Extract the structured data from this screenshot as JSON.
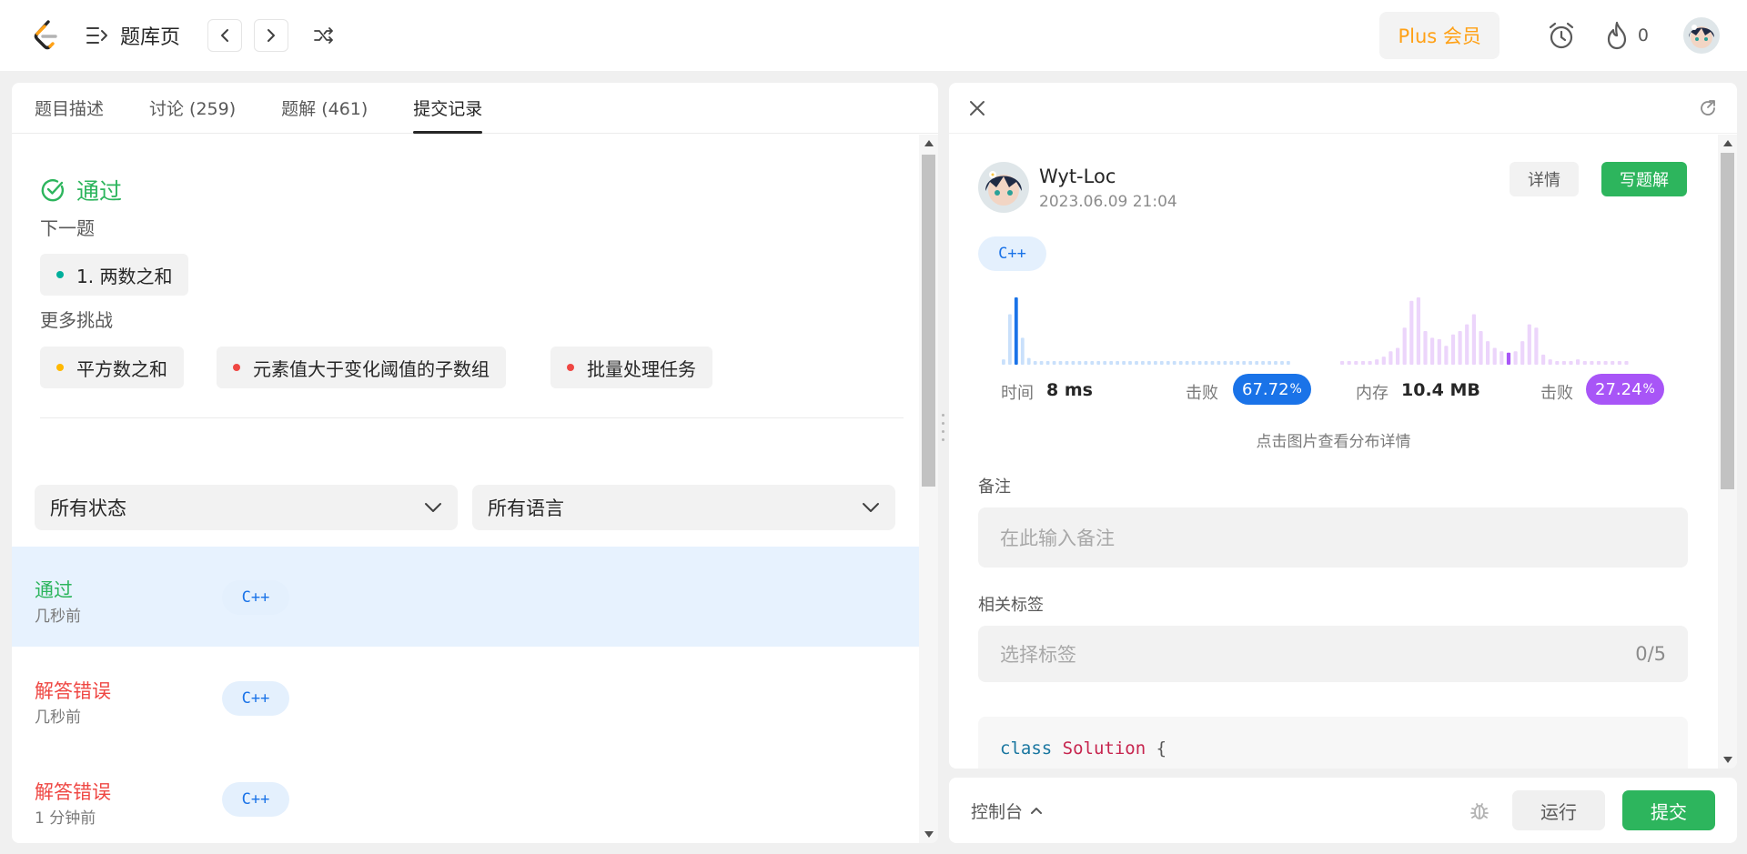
{
  "topbar": {
    "title": "题库页",
    "plus_label": "Plus 会员",
    "streak_count": "0",
    "brand_color": "#ffa116"
  },
  "left": {
    "tabs": [
      "题目描述",
      "讨论 (259)",
      "题解 (461)",
      "提交记录"
    ],
    "active_tab": "提交记录",
    "result": "通过",
    "next_label": "下一题",
    "next_problem": "1. 两数之和",
    "more_label": "更多挑战",
    "challenges": [
      {
        "label": "平方数之和",
        "color": "#ffb800"
      },
      {
        "label": "元素值大于变化阈值的子数组",
        "color": "#ef4743"
      },
      {
        "label": "批量处理任务",
        "color": "#ef4743"
      }
    ],
    "next_dot_color": "#00af9b",
    "filter_status": "所有状态",
    "filter_lang": "所有语言",
    "submissions": [
      {
        "status": "通过",
        "time": "几秒前",
        "lang": "C++",
        "color": "#2db55d"
      },
      {
        "status": "解答错误",
        "time": "几秒前",
        "lang": "C++",
        "color": "#ef4743"
      },
      {
        "status": "解答错误",
        "time": "1 分钟前",
        "lang": "C++",
        "color": "#ef4743"
      }
    ]
  },
  "right": {
    "user_name": "Wyt-Loc",
    "date": "2023.06.09 21:04",
    "detail_btn": "详情",
    "write_btn": "写题解",
    "lang": "C++",
    "time_label": "时间",
    "time_value": "8 ms",
    "beat_label_1": "击败",
    "time_beat": "67.72",
    "memory_label": "内存",
    "memory_value": "10.4 MB",
    "beat_label_2": "击败",
    "memory_beat": "27.24",
    "percent_sign": "%",
    "hint": "点击图片查看分布详情",
    "note_label": "备注",
    "note_placeholder": "在此输入备注",
    "tags_label": "相关标签",
    "tags_placeholder": "选择标签",
    "tags_count": "0/5",
    "code_keyword": "class",
    "code_class": "Solution",
    "code_brace": "{",
    "time_color": "#1a73e8",
    "memory_color": "#a855f7",
    "time_bars": [
      0.08,
      0.75,
      1,
      0.4,
      0.1,
      0.05,
      0.05,
      0.05,
      0.05,
      0.05,
      0.05,
      0.05,
      0.05,
      0.05,
      0.05,
      0.05,
      0.05,
      0.05,
      0.05,
      0.05,
      0.05,
      0.05,
      0.05,
      0.05,
      0.05,
      0.05,
      0.05,
      0.05,
      0.05,
      0.05,
      0.05,
      0.05,
      0.05,
      0.05,
      0.05,
      0.05,
      0.05,
      0.05,
      0.05,
      0.05,
      0.05,
      0.05,
      0.05,
      0.05,
      0.05,
      0.05
    ],
    "time_highlight": 2,
    "memory_bars": [
      0.05,
      0.05,
      0.05,
      0.05,
      0.05,
      0.08,
      0.12,
      0.2,
      0.25,
      0.55,
      0.95,
      1,
      0.5,
      0.4,
      0.38,
      0.28,
      0.45,
      0.5,
      0.6,
      0.75,
      0.5,
      0.35,
      0.25,
      0.2,
      0.18,
      0.2,
      0.35,
      0.6,
      0.55,
      0.15,
      0.08,
      0.05,
      0.05,
      0.05,
      0.08,
      0.05,
      0.05,
      0.05,
      0.05,
      0.05,
      0.05,
      0.05
    ],
    "memory_highlight": 24
  },
  "console": {
    "label": "控制台",
    "run": "运行",
    "submit": "提交"
  }
}
